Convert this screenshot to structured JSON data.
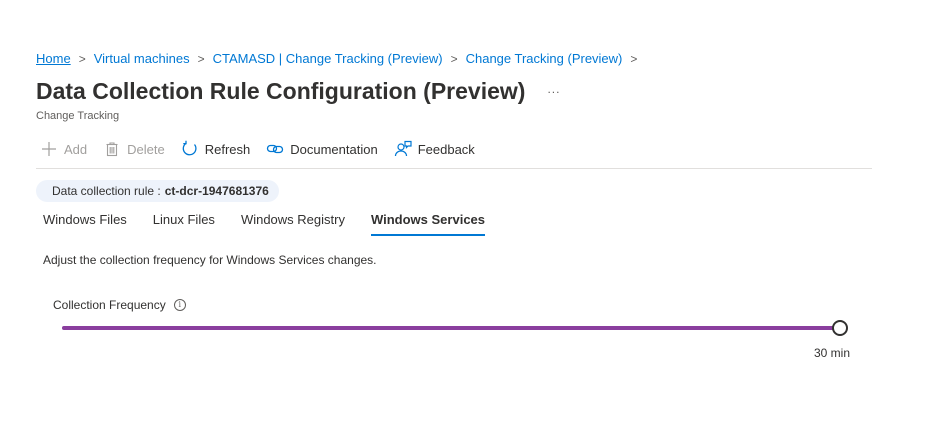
{
  "breadcrumb": {
    "items": [
      "Home",
      "Virtual machines",
      "CTAMASD | Change Tracking (Preview)",
      "Change Tracking (Preview)"
    ],
    "separator": ">"
  },
  "header": {
    "title": "Data Collection Rule Configuration (Preview)",
    "more": "...",
    "subtitle": "Change Tracking"
  },
  "toolbar": {
    "add_label": "Add",
    "delete_label": "Delete",
    "refresh_label": "Refresh",
    "documentation_label": "Documentation",
    "feedback_label": "Feedback"
  },
  "dcr": {
    "label": "Data collection rule :",
    "value": "ct-dcr-1947681376"
  },
  "tabs": [
    {
      "label": "Windows Files",
      "active": false
    },
    {
      "label": "Linux Files",
      "active": false
    },
    {
      "label": "Windows Registry",
      "active": false
    },
    {
      "label": "Windows Services",
      "active": true
    }
  ],
  "content": {
    "description": "Adjust the collection frequency for Windows Services changes.",
    "frequency_label": "Collection Frequency",
    "info_glyph": "i",
    "slider_fraction": 1.0,
    "slider_value_text": "30 min"
  },
  "colors": {
    "accent": "#0078d4",
    "slider_fill": "#8a3e9e"
  }
}
